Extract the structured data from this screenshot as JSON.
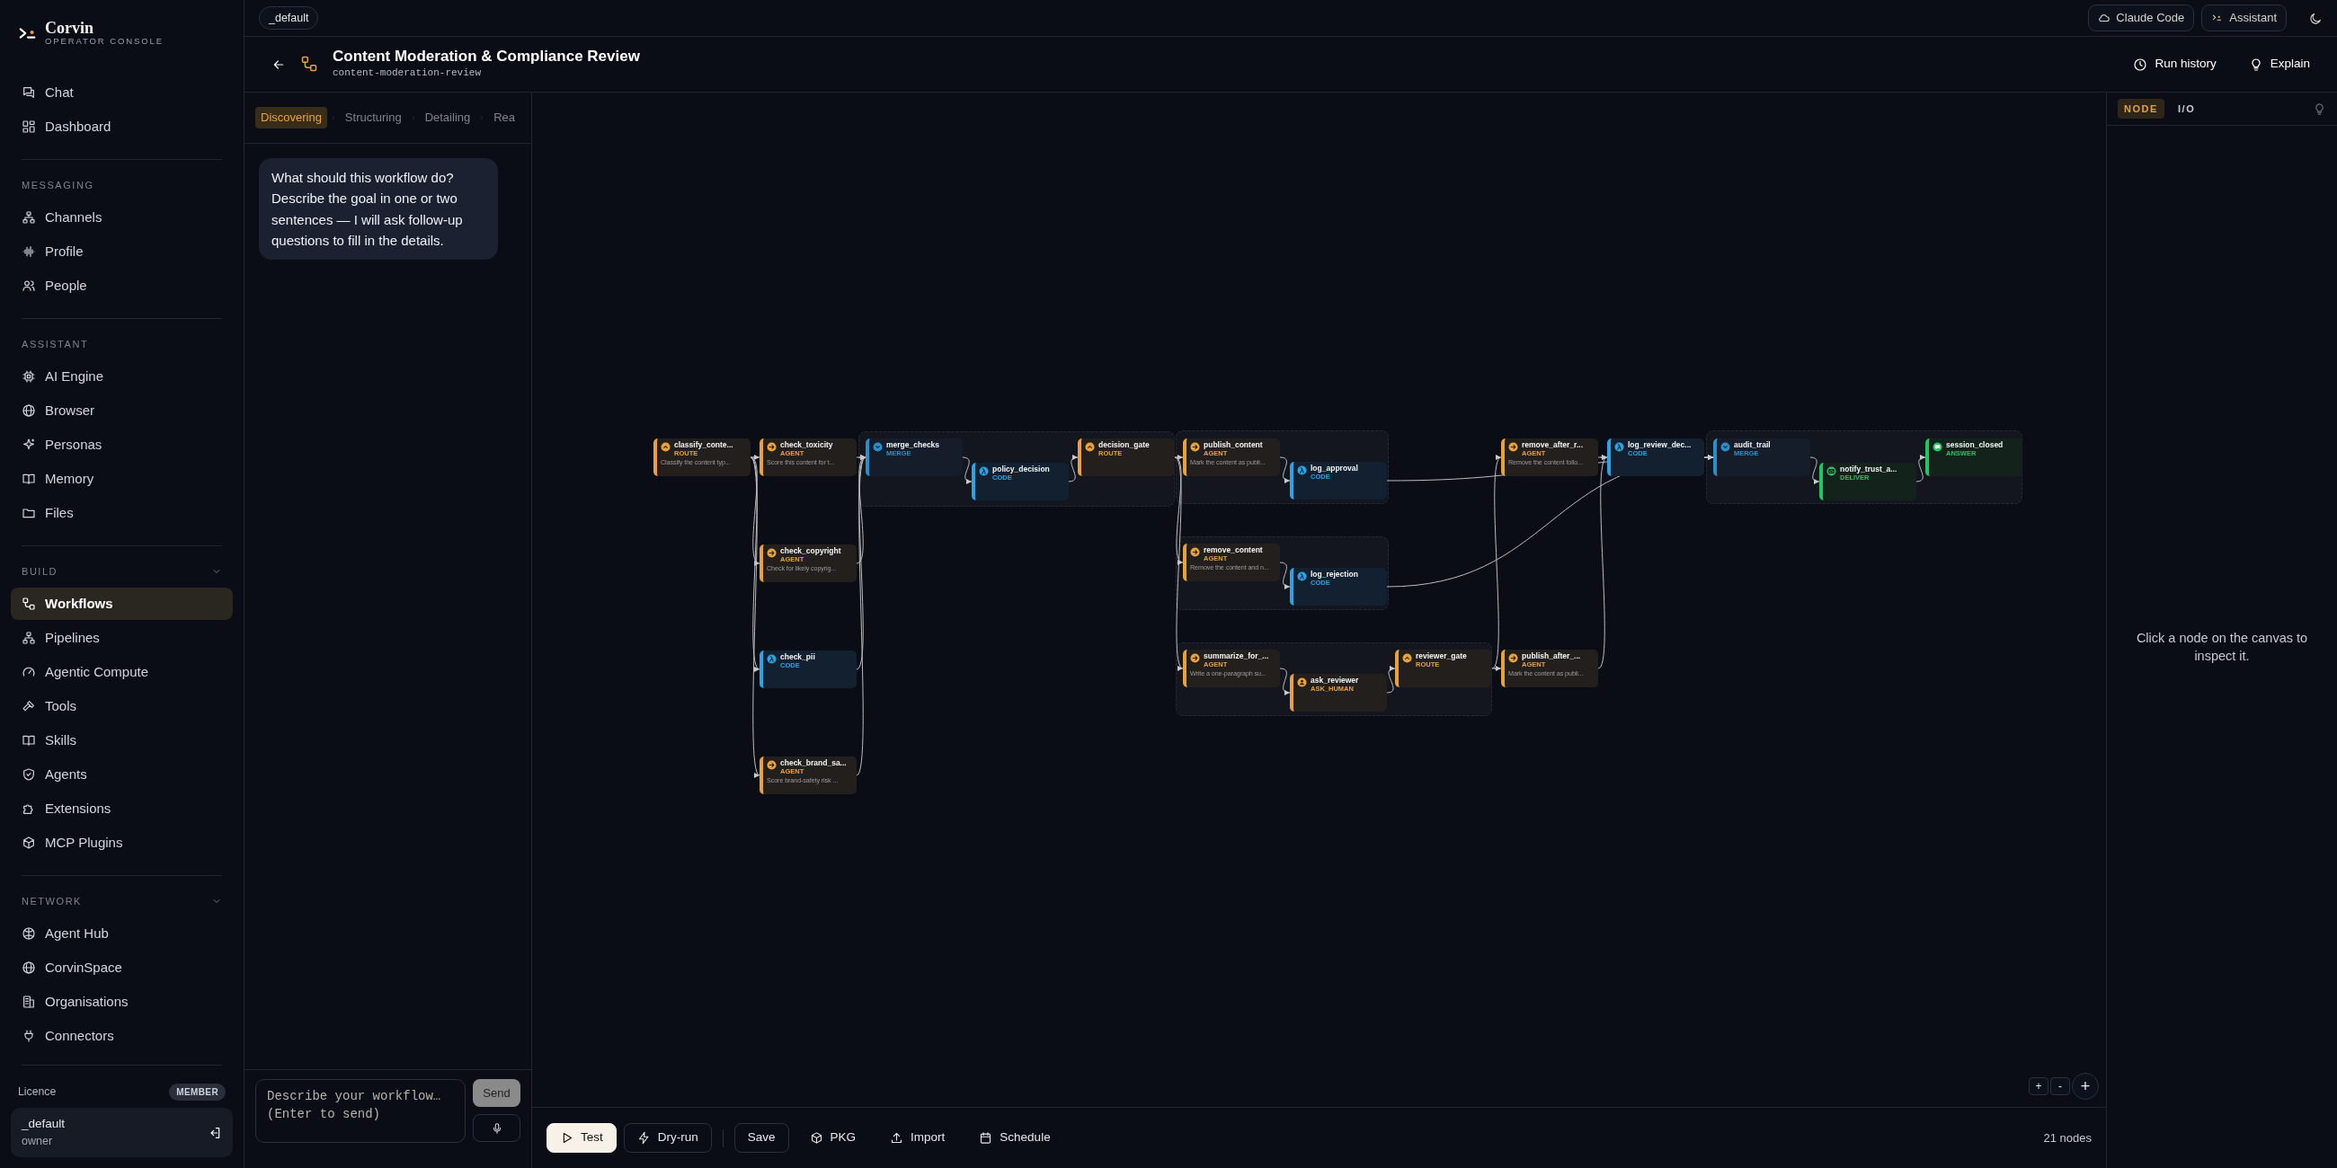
{
  "sidebar": {
    "brand": {
      "name": "Corvin",
      "tagline": "OPERATOR CONSOLE"
    },
    "top_items": [
      {
        "label": "Chat",
        "selected": false
      },
      {
        "label": "Dashboard",
        "selected": false
      }
    ],
    "sections": [
      {
        "title": "MESSAGING",
        "collapsible": false,
        "items": [
          {
            "label": "Channels",
            "selected": false
          },
          {
            "label": "Profile",
            "selected": false
          },
          {
            "label": "People",
            "selected": false
          }
        ]
      },
      {
        "title": "ASSISTANT",
        "collapsible": false,
        "items": [
          {
            "label": "AI Engine",
            "selected": false
          },
          {
            "label": "Browser",
            "selected": false
          },
          {
            "label": "Personas",
            "selected": false
          },
          {
            "label": "Memory",
            "selected": false
          },
          {
            "label": "Files",
            "selected": false
          }
        ]
      },
      {
        "title": "BUILD",
        "collapsible": true,
        "items": [
          {
            "label": "Workflows",
            "selected": true
          },
          {
            "label": "Pipelines",
            "selected": false
          },
          {
            "label": "Agentic Compute",
            "selected": false
          },
          {
            "label": "Tools",
            "selected": false
          },
          {
            "label": "Skills",
            "selected": false
          },
          {
            "label": "Agents",
            "selected": false
          },
          {
            "label": "Extensions",
            "selected": false
          },
          {
            "label": "MCP Plugins",
            "selected": false
          }
        ]
      },
      {
        "title": "NETWORK",
        "collapsible": true,
        "items": [
          {
            "label": "Agent Hub",
            "selected": false
          },
          {
            "label": "CorvinSpace",
            "selected": false
          },
          {
            "label": "Organisations",
            "selected": false
          },
          {
            "label": "Connectors",
            "selected": false
          }
        ]
      }
    ],
    "licence": {
      "label": "Licence",
      "badge": "MEMBER"
    },
    "user": {
      "name": "_default",
      "role": "owner"
    }
  },
  "top_bar": {
    "workspace": "_default",
    "buttons": [
      "Claude Code",
      "Assistant"
    ]
  },
  "header": {
    "title": "Content Moderation & Compliance Review",
    "slug": "content-moderation-review",
    "actions": [
      "Run history",
      "Explain"
    ]
  },
  "chat": {
    "steps": [
      {
        "label": "Discovering",
        "selected": true
      },
      {
        "label": "Structuring",
        "selected": false
      },
      {
        "label": "Detailing",
        "selected": false
      },
      {
        "label": "Rea",
        "selected": false
      }
    ],
    "messages": [
      {
        "text": "What should this workflow do? Describe the goal in one or two sentences — I will ask follow-up questions to fill in the details."
      }
    ],
    "composer": {
      "placeholder": "Describe your workflow… (Enter to send)",
      "send": "Send",
      "send_disabled": true
    }
  },
  "canvas": {
    "nodes": [
      {
        "name": "classify_conte...",
        "kind": "route",
        "type_label": "ROUTE",
        "description": "Classify the content typ..."
      },
      {
        "name": "check_toxicity",
        "kind": "agent",
        "type_label": "AGENT",
        "description": "Score this content for t..."
      },
      {
        "name": "check_copyright",
        "kind": "agent",
        "type_label": "AGENT",
        "description": "Check for likely copyrig..."
      },
      {
        "name": "check_pii",
        "kind": "code",
        "type_label": "CODE"
      },
      {
        "name": "check_brand_sa...",
        "kind": "agent",
        "type_label": "AGENT",
        "description": "Score brand-safety risk ..."
      },
      {
        "name": "merge_checks",
        "kind": "merge",
        "type_label": "MERGE"
      },
      {
        "name": "policy_decision",
        "kind": "code",
        "type_label": "CODE"
      },
      {
        "name": "decision_gate",
        "kind": "route",
        "type_label": "ROUTE"
      },
      {
        "name": "publish_content",
        "kind": "agent",
        "type_label": "AGENT",
        "description": "Mark the content as publi..."
      },
      {
        "name": "log_approval",
        "kind": "code",
        "type_label": "CODE"
      },
      {
        "name": "remove_content",
        "kind": "agent",
        "type_label": "AGENT",
        "description": "Remove the content and n..."
      },
      {
        "name": "log_rejection",
        "kind": "code",
        "type_label": "CODE"
      },
      {
        "name": "summarize_for_...",
        "kind": "agent",
        "type_label": "AGENT",
        "description": "Write a one-paragraph su..."
      },
      {
        "name": "ask_reviewer",
        "kind": "ask_human",
        "type_label": "ASK_HUMAN"
      },
      {
        "name": "reviewer_gate",
        "kind": "route",
        "type_label": "ROUTE"
      },
      {
        "name": "remove_after_r...",
        "kind": "agent",
        "type_label": "AGENT",
        "description": "Remove the content follo..."
      },
      {
        "name": "publish_after_...",
        "kind": "agent",
        "type_label": "AGENT",
        "description": "Mark the content as publi..."
      },
      {
        "name": "log_review_dec...",
        "kind": "code",
        "type_label": "CODE"
      },
      {
        "name": "audit_trail",
        "kind": "merge",
        "type_label": "MERGE"
      },
      {
        "name": "notify_trust_a...",
        "kind": "deliver",
        "type_label": "DELIVER"
      },
      {
        "name": "session_closed",
        "kind": "answer",
        "type_label": "ANSWER"
      }
    ],
    "zoom_controls": [
      "+",
      "-",
      "+"
    ],
    "toolbar": [
      {
        "label": "Test",
        "kind": "primary"
      },
      {
        "label": "Dry-run",
        "kind": "outline"
      },
      {
        "label": "Save",
        "kind": "outline"
      },
      {
        "label": "PKG",
        "kind": "plain"
      },
      {
        "label": "Import",
        "kind": "plain"
      },
      {
        "label": "Schedule",
        "kind": "plain"
      }
    ],
    "node_count": "21 nodes"
  },
  "inspector": {
    "tabs": [
      {
        "label": "NODE",
        "selected": true
      },
      {
        "label": "I/O",
        "selected": false
      }
    ],
    "empty_text": "Click a node on the canvas to inspect it."
  }
}
